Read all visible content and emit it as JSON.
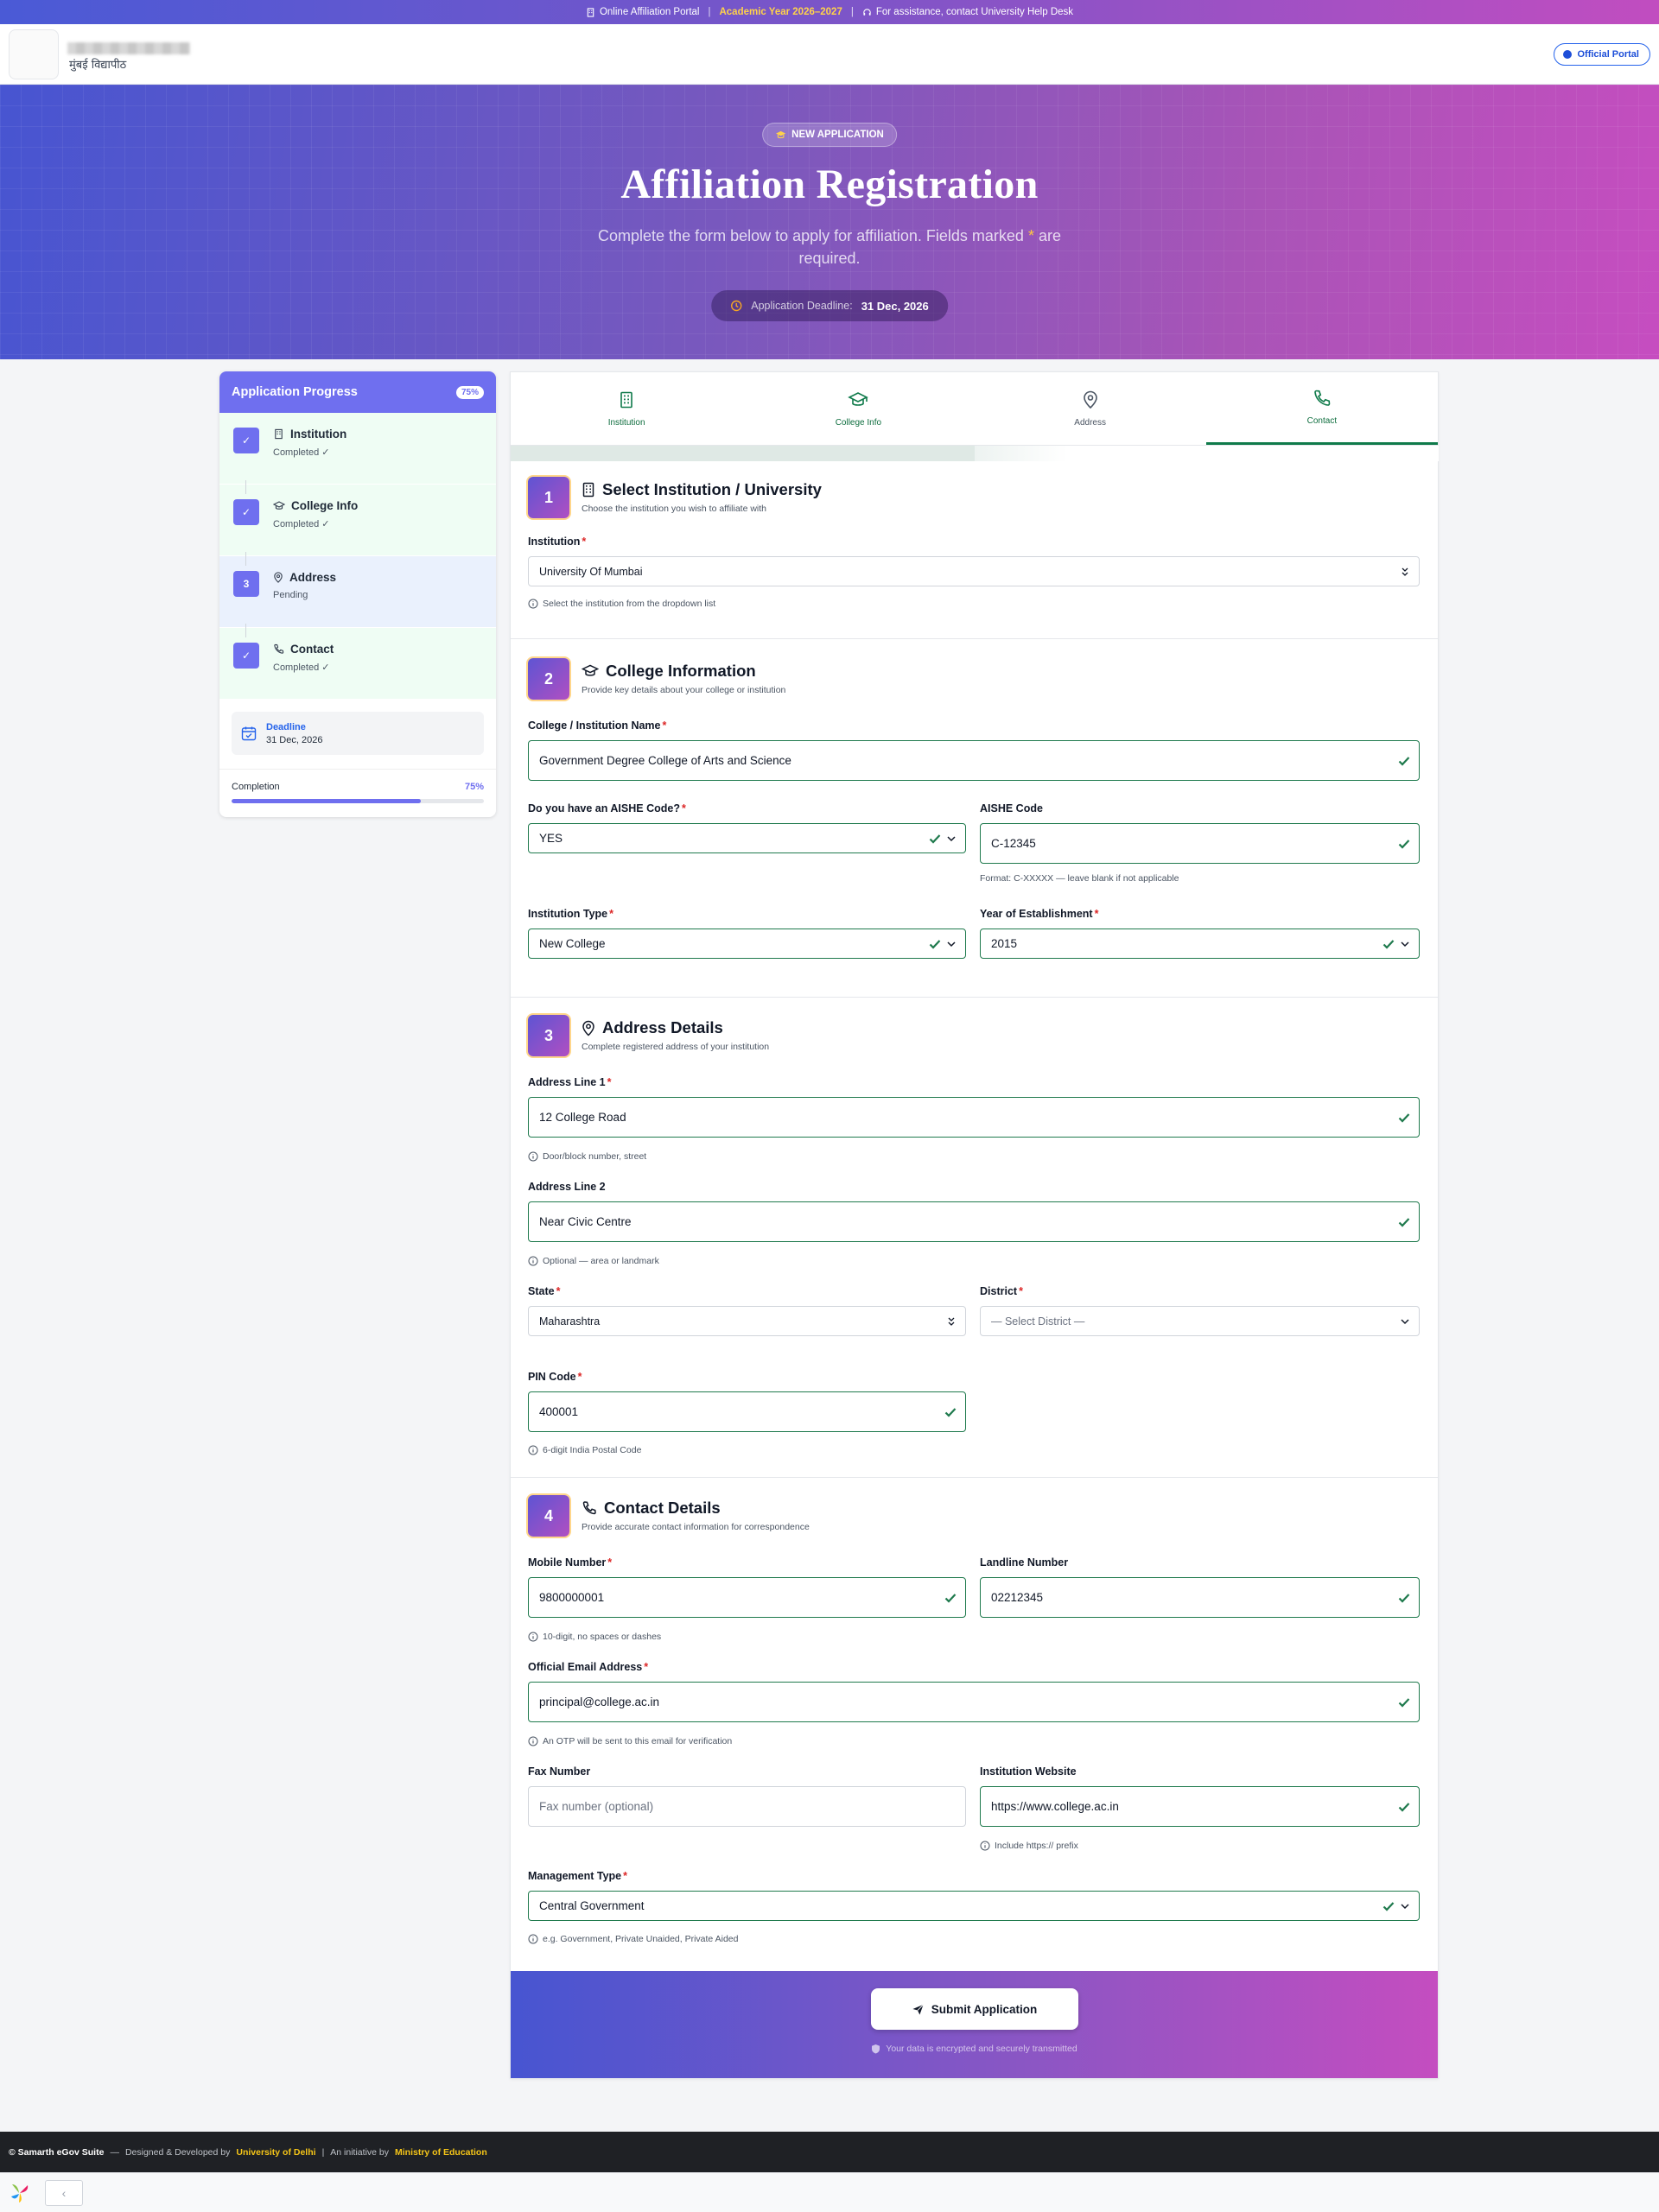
{
  "topbar": {
    "portal": "Online Affiliation Portal",
    "sep": "|",
    "year": "Academic Year 2026–2027",
    "help": "For assistance, contact University Help Desk"
  },
  "header": {
    "univ_name_hi": "मुंबई विद्यापीठ",
    "official_label": "Official Portal"
  },
  "hero": {
    "badge": "NEW APPLICATION",
    "title": "Affiliation Registration",
    "subtitle_pre": "Complete the form below to apply for affiliation. Fields marked",
    "subtitle_star": "*",
    "subtitle_post": "are required.",
    "deadline_label": "Application Deadline:",
    "deadline_value": "31 Dec, 2026"
  },
  "sidebar": {
    "title": "Application Progress",
    "percent_badge": "75%",
    "steps": [
      {
        "num": "✓",
        "label": "Institution",
        "status": "Completed ✓"
      },
      {
        "num": "✓",
        "label": "College Info",
        "status": "Completed ✓"
      },
      {
        "num": "3",
        "label": "Address",
        "status": "Pending"
      },
      {
        "num": "✓",
        "label": "Contact",
        "status": "Completed ✓"
      }
    ],
    "deadline_label": "Deadline",
    "deadline_value": "31 Dec, 2026",
    "completion_label": "Completion",
    "completion_value": "75%",
    "completion_fraction": 0.75
  },
  "tabs": [
    {
      "label": "Institution"
    },
    {
      "label": "College Info"
    },
    {
      "label": "Address"
    },
    {
      "label": "Contact"
    }
  ],
  "sections": {
    "s1": {
      "num": "1",
      "title": "Select Institution / University",
      "desc": "Choose the institution you wish to affiliate with",
      "institution_label": "Institution",
      "institution_value": "University Of Mumbai",
      "institution_hint": "Select the institution from the dropdown list"
    },
    "s2": {
      "num": "2",
      "title": "College Information",
      "desc": "Provide key details about your college or institution",
      "name_label": "College / Institution Name",
      "name_value": "Government Degree College of Arts and Science",
      "aishe_q_label": "Do you have an AISHE Code?",
      "aishe_q_value": "YES",
      "aishe_code_label": "AISHE Code",
      "aishe_code_value": "C-12345",
      "aishe_hint": "Format: C-XXXXX — leave blank if not applicable",
      "type_label": "Institution Type",
      "type_value": "New College",
      "year_label": "Year of Establishment",
      "year_value": "2015"
    },
    "s3": {
      "num": "3",
      "title": "Address Details",
      "desc": "Complete registered address of your institution",
      "addr1_label": "Address Line 1",
      "addr1_value": "12 College Road",
      "addr1_hint": "Door/block number, street",
      "addr2_label": "Address Line 2",
      "addr2_value": "Near Civic Centre",
      "addr2_hint": "Optional — area or landmark",
      "state_label": "State",
      "state_value": "Maharashtra",
      "district_label": "District",
      "district_placeholder": "— Select District —",
      "pin_label": "PIN Code",
      "pin_value": "400001",
      "pin_hint": "6-digit India Postal Code"
    },
    "s4": {
      "num": "4",
      "title": "Contact Details",
      "desc": "Provide accurate contact information for correspondence",
      "mobile_label": "Mobile Number",
      "mobile_value": "9800000001",
      "mobile_hint": "10-digit, no spaces or dashes",
      "landline_label": "Landline Number",
      "landline_value": "02212345",
      "email_label": "Official Email Address",
      "email_value": "principal@college.ac.in",
      "email_hint": "An OTP will be sent to this email for verification",
      "fax_label": "Fax Number",
      "fax_placeholder": "Fax number (optional)",
      "website_label": "Institution Website",
      "website_value": "https://www.college.ac.in",
      "website_hint": "Include https:// prefix",
      "mgmt_label": "Management Type",
      "mgmt_value": "Central Government",
      "mgmt_hint": "e.g. Government, Private Unaided, Private Aided"
    }
  },
  "required_mark": "*",
  "submit": {
    "label": "Submit Application",
    "secure_note": "Your data is encrypted and securely transmitted"
  },
  "footer": {
    "brand": "© Samarth eGov Suite",
    "dash": "—",
    "designed": "Designed & Developed by",
    "dev": "University of Delhi",
    "sep": "|",
    "initiative": "An initiative by",
    "ministry": "Ministry of Education"
  },
  "bottombar": {
    "back_glyph": "‹"
  },
  "colors": {
    "accent": "#6f6fef",
    "valid": "#1f7a4d",
    "required": "#dc2626",
    "highlight": "#ffd24a"
  }
}
